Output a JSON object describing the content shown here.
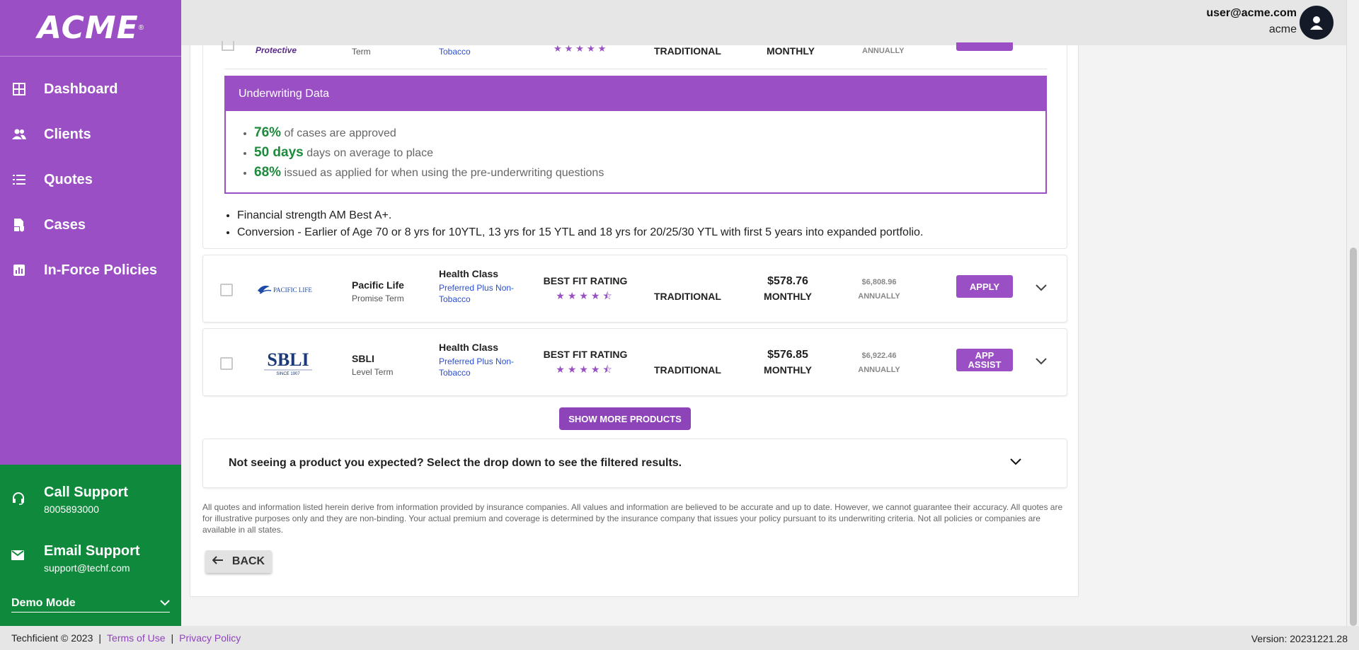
{
  "sidebar": {
    "logo": "ACME",
    "logo_mark": "®",
    "items": [
      {
        "label": "Dashboard",
        "icon": "dashboard-icon"
      },
      {
        "label": "Clients",
        "icon": "users-icon"
      },
      {
        "label": "Quotes",
        "icon": "list-icon"
      },
      {
        "label": "Cases",
        "icon": "case-icon"
      },
      {
        "label": "In-Force Policies",
        "icon": "chart-icon"
      }
    ],
    "support": {
      "call_title": "Call Support",
      "call_value": "8005893000",
      "email_title": "Email Support",
      "email_value": "support@techf.com",
      "mode": "Demo Mode"
    }
  },
  "header": {
    "email": "user@acme.com",
    "org": "acme"
  },
  "partial_product": {
    "carrier_logo_text": "Protective",
    "product": "Term",
    "health_class": "Tobacco",
    "type": "TRADITIONAL",
    "monthly": "MONTHLY",
    "annually": "ANNUALLY"
  },
  "underwriting": {
    "title": "Underwriting Data",
    "items": [
      {
        "value": "76%",
        "text": "of cases are approved"
      },
      {
        "value": "50 days",
        "text": "days on average to place"
      },
      {
        "value": "68%",
        "text": "issued as applied for when using the pre-underwriting questions"
      }
    ]
  },
  "notes": [
    "Financial strength AM Best A+.",
    "Conversion - Earlier of Age 70 or 8 yrs for 10YTL, 13 yrs for 15 YTL and 18 yrs for 20/25/30 YTL with first 5 years into expanded portfolio."
  ],
  "products": [
    {
      "logo_text": "PACIFIC LIFE",
      "carrier": "Pacific Life",
      "product": "Promise Term",
      "health_label": "Health Class",
      "health_class": "Preferred Plus Non-Tobacco",
      "rating_label": "BEST FIT RATING",
      "stars": "★★★★⯪",
      "rating": 4.5,
      "type": "TRADITIONAL",
      "monthly_price": "$578.76",
      "monthly_label": "MONTHLY",
      "annual_price": "$6,808.96",
      "annual_label": "ANNUALLY",
      "action": "APPLY"
    },
    {
      "logo_text": "SBLI",
      "logo_sub": "SINCE 1907",
      "carrier": "SBLI",
      "product": "Level Term",
      "health_label": "Health Class",
      "health_class": "Preferred Plus Non-Tobacco",
      "rating_label": "BEST FIT RATING",
      "stars": "★★★★⯪",
      "rating": 4.5,
      "type": "TRADITIONAL",
      "monthly_price": "$576.85",
      "monthly_label": "MONTHLY",
      "annual_price": "$6,922.46",
      "annual_label": "ANNUALLY",
      "action": "APP ASSIST"
    }
  ],
  "show_more": "SHOW MORE PRODUCTS",
  "filter_text": "Not seeing a product you expected? Select the drop down to see the filtered results.",
  "disclaimer": "All quotes and information listed herein derive from information provided by insurance companies. All values and information are believed to be accurate and up to date. However, we cannot guarantee their accuracy. All quotes are for illustrative purposes only and they are non-binding. Your actual premium and coverage is determined by the insurance company that issues your policy pursuant to its underwriting criteria. Not all policies or companies are available in all states.",
  "back": "BACK",
  "footer": {
    "copyright": "Techficient © 2023",
    "terms": "Terms of Use",
    "privacy": "Privacy Policy",
    "version": "Version: 20231221.28"
  },
  "colors": {
    "brand_purple": "#9b4fc4",
    "support_green": "#0f8a3c",
    "stat_green": "#1d8a3c",
    "link_blue": "#2a4fcf"
  }
}
